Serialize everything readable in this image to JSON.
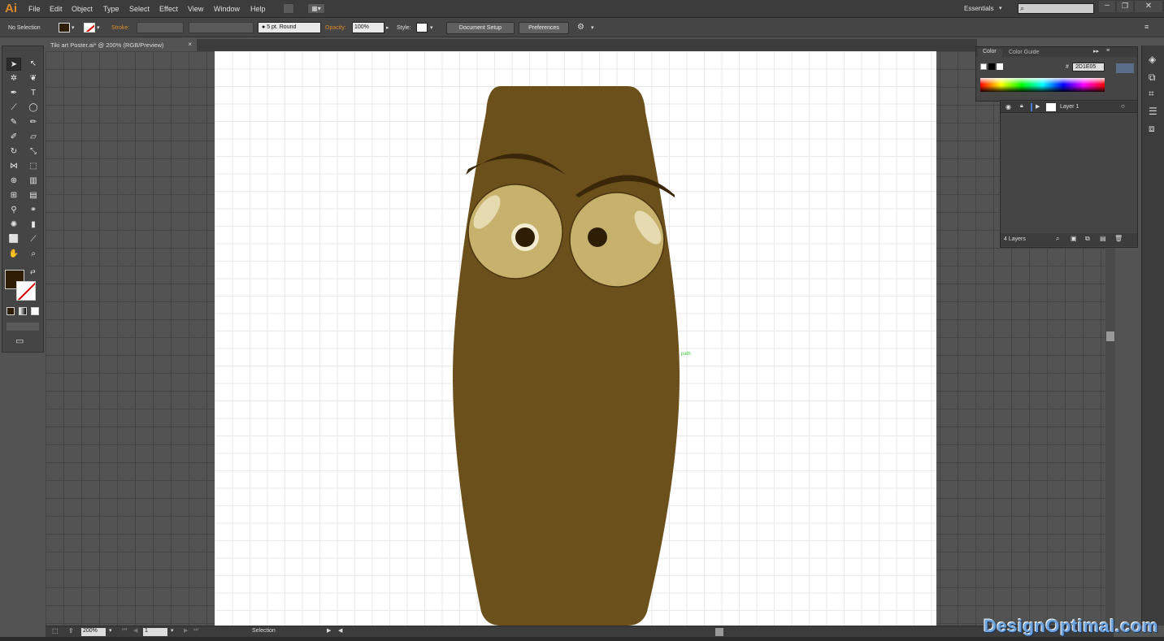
{
  "app": {
    "logo": "Ai"
  },
  "menu": [
    "File",
    "Edit",
    "Object",
    "Type",
    "Select",
    "Effect",
    "View",
    "Window",
    "Help"
  ],
  "workspace": "Essentials",
  "control": {
    "selection": "No Selection",
    "stroke_label": "Stroke:",
    "brush": "5 pt. Round",
    "opacity_label": "Opacity:",
    "opacity": "100%",
    "style_label": "Style:",
    "doc_setup": "Document Setup",
    "preferences": "Preferences"
  },
  "document": {
    "tab": "Tiki art Poster.ai* @ 200% (RGB/Preview)"
  },
  "canvas": {
    "path_hint": "path"
  },
  "color_panel": {
    "tab1": "Color",
    "tab2": "Color Guide",
    "hex_label": "#",
    "hex": "2D1E05"
  },
  "layers_panel": {
    "layer_name": "Layer 1",
    "count": "4 Layers"
  },
  "status": {
    "zoom": "200%",
    "page": "1",
    "tool": "Selection"
  },
  "colors": {
    "body": "#6b501b",
    "eye": "#c7b26d",
    "brow": "#3a2608",
    "pupil": "#2d1e05",
    "fill_swatch": "#2d1e05"
  },
  "watermark": "DesignOptimal.com"
}
